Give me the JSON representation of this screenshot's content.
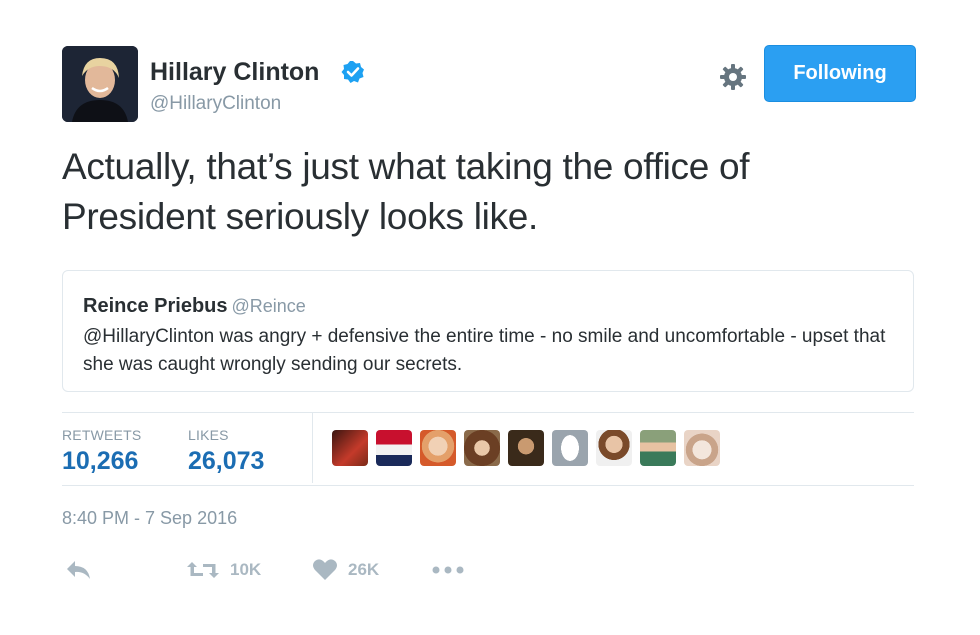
{
  "colors": {
    "accent": "#2b9ff2",
    "verified": "#1da1f2",
    "stat": "#1b6db3",
    "muted": "#8899a6"
  },
  "author": {
    "name": "Hillary Clinton",
    "handle": "@HillaryClinton",
    "verified_icon": "verified-badge-icon"
  },
  "header": {
    "follow_label": "Following",
    "settings_icon": "gear-icon"
  },
  "tweet": {
    "text": "Actually, that’s just what taking the office of President seriously looks like."
  },
  "quote": {
    "name": "Reince Priebus",
    "handle": "@Reince",
    "text": "@HillaryClinton was angry + defensive the entire time - no smile and uncomfortable - upset that she was caught wrongly sending our secrets."
  },
  "stats": {
    "retweets_label": "RETWEETS",
    "retweets_value": "10,266",
    "likes_label": "LIKES",
    "likes_value": "26,073"
  },
  "likers": [
    "liker-avatar-1",
    "liker-avatar-2",
    "liker-avatar-3",
    "liker-avatar-4",
    "liker-avatar-5",
    "liker-avatar-6",
    "liker-avatar-7",
    "liker-avatar-8",
    "liker-avatar-9"
  ],
  "timestamp": "8:40 PM - 7 Sep 2016",
  "actions": {
    "reply_icon": "reply-icon",
    "retweet_icon": "retweet-icon",
    "retweet_count": "10K",
    "like_icon": "heart-icon",
    "like_count": "26K",
    "more_icon": "more-icon"
  }
}
